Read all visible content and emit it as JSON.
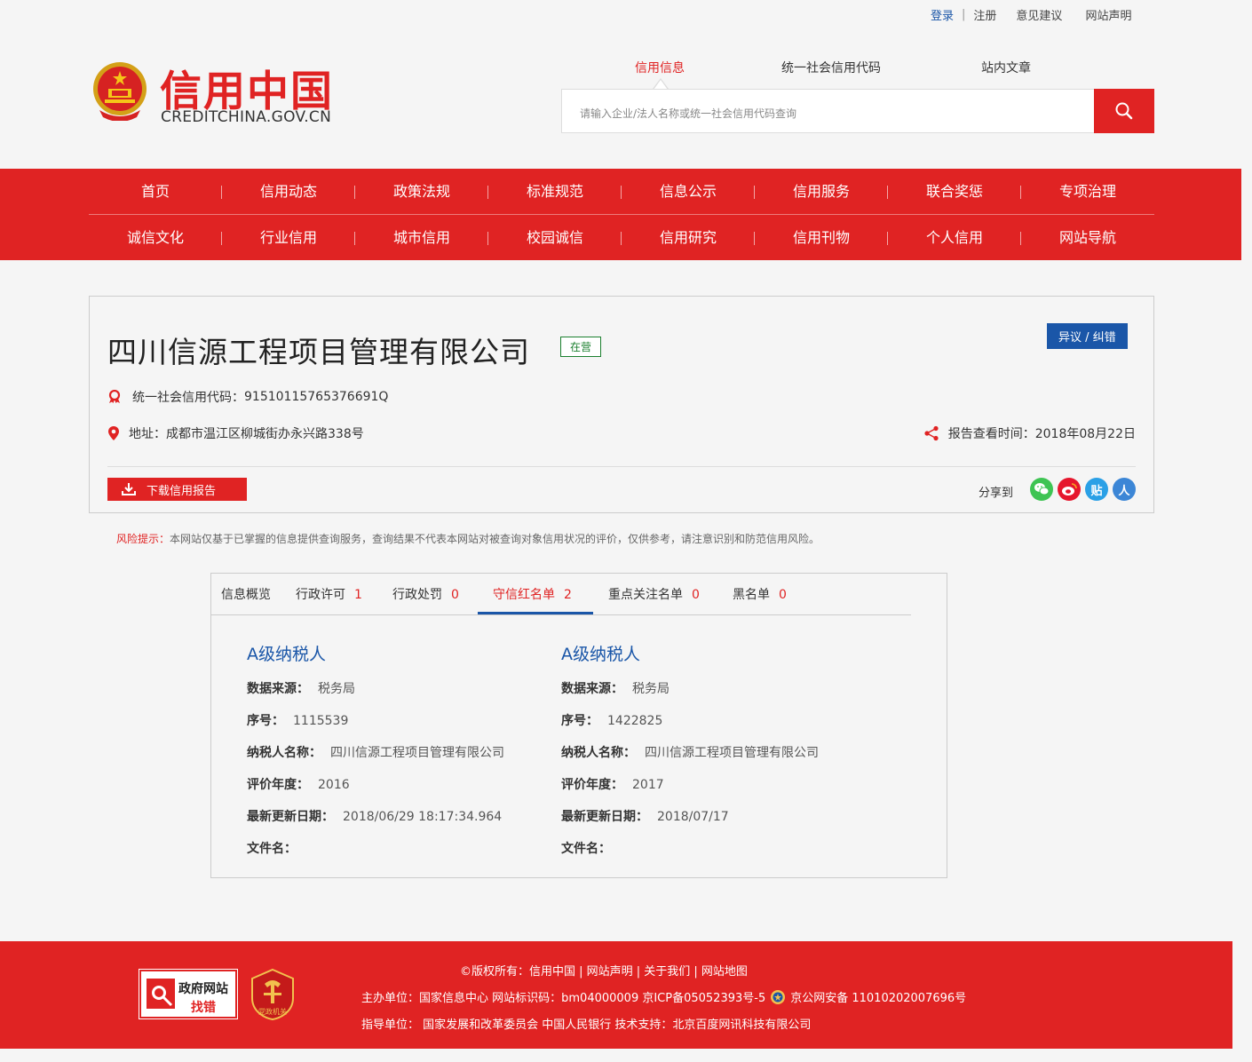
{
  "top_links": {
    "login": "登录",
    "register": "注册",
    "feedback": "意见建议",
    "statement": "网站声明"
  },
  "logo": {
    "cn": "信用中国",
    "en": "CREDITCHINA.GOV.CN"
  },
  "search": {
    "tabs": [
      "信用信息",
      "统一社会信用代码",
      "站内文章"
    ],
    "placeholder": "请输入企业/法人名称或统一社会信用代码查询"
  },
  "nav": {
    "row1": [
      "首页",
      "信用动态",
      "政策法规",
      "标准规范",
      "信息公示",
      "信用服务",
      "联合奖惩",
      "专项治理"
    ],
    "row2": [
      "诚信文化",
      "行业信用",
      "城市信用",
      "校园诚信",
      "信用研究",
      "信用刊物",
      "个人信用",
      "网站导航"
    ]
  },
  "company": {
    "name": "四川信源工程项目管理有限公司",
    "status": "在营",
    "dispute": "异议 / 纠错",
    "code_label": "统一社会信用代码：",
    "code": "91510115765376691Q",
    "address_label": "地址：",
    "address": "成都市温江区柳城街办永兴路338号",
    "report_time_label": "报告查看时间：",
    "report_time": "2018年08月22日",
    "download": "下载信用报告",
    "share_label": "分享到",
    "share_tieba": "贴",
    "share_renren": "人"
  },
  "risk": {
    "label": "风险提示：",
    "text": "本网站仅基于已掌握的信息提供查询服务，查询结果不代表本网站对被查询对象信用状况的评价，仅供参考，请注意识别和防范信用风险。"
  },
  "tabs": [
    {
      "label": "信息概览",
      "count": ""
    },
    {
      "label": "行政许可",
      "count": "1"
    },
    {
      "label": "行政处罚",
      "count": "0"
    },
    {
      "label": "守信红名单",
      "count": "2"
    },
    {
      "label": "重点关注名单",
      "count": "0"
    },
    {
      "label": "黑名单",
      "count": "0"
    }
  ],
  "records": [
    {
      "title": "A级纳税人",
      "source_label": "数据来源：",
      "source": "税务局",
      "seq_label": "序号：",
      "seq": "1115539",
      "taxpayer_label": "纳税人名称：",
      "taxpayer": "四川信源工程项目管理有限公司",
      "year_label": "评价年度：",
      "year": "2016",
      "updated_label": "最新更新日期：",
      "updated": "2018/06/29 18:17:34.964",
      "file_label": "文件名："
    },
    {
      "title": "A级纳税人",
      "source_label": "数据来源：",
      "source": "税务局",
      "seq_label": "序号：",
      "seq": "1422825",
      "taxpayer_label": "纳税人名称：",
      "taxpayer": "四川信源工程项目管理有限公司",
      "year_label": "评价年度：",
      "year": "2017",
      "updated_label": "最新更新日期：",
      "updated": "2018/07/17",
      "file_label": "文件名："
    }
  ],
  "footer": {
    "badge_line1": "政府网站",
    "badge_line2": "找错",
    "party_badge_text": "党政机关",
    "line1": "©版权所有：信用中国 |  网站声明 |  关于我们 |  网站地图",
    "line2_a": "主办单位：国家信息中心  网站标识码：bm04000009  京ICP备05052393号-5",
    "line2_b": "京公网安备 11010202007696号",
    "line3": "指导单位： 国家发展和改革委员会  中国人民银行  技术支持：北京百度网讯科技有限公司"
  },
  "colors": {
    "brand_red": "#e02323",
    "link_blue": "#1a56a8",
    "status_green": "#1a7f2e",
    "wechat": "#3ec453",
    "weibo": "#e6162d",
    "tieba": "#2aa0e6",
    "renren": "#3c86d6"
  }
}
